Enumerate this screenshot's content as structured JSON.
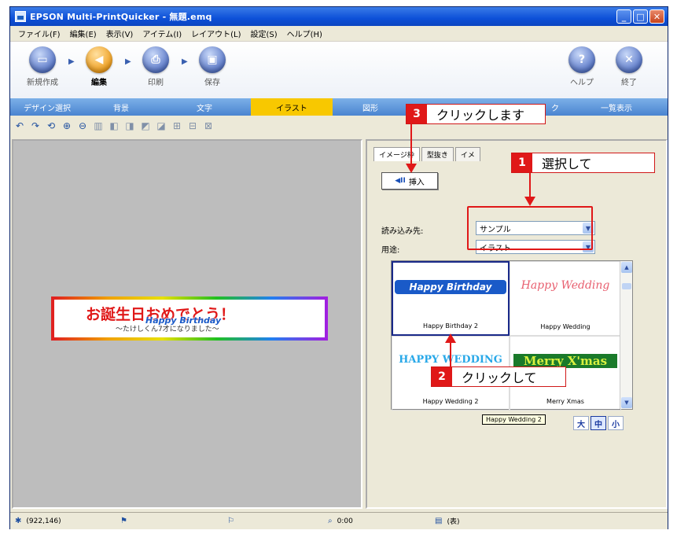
{
  "window": {
    "title": "EPSON Multi-PrintQuicker - 無題.emq"
  },
  "menu": [
    "ファイル(F)",
    "編集(E)",
    "表示(V)",
    "アイテム(I)",
    "レイアウト(L)",
    "設定(S)",
    "ヘルプ(H)"
  ],
  "toolbar": {
    "new_label": "新規作成",
    "edit_label": "編集",
    "print_label": "印刷",
    "save_label": "保存",
    "help_label": "ヘルプ",
    "exit_label": "終了"
  },
  "tabs": [
    "デザイン選択",
    "背景",
    "文字",
    "イラスト",
    "図形",
    "ク",
    "一覧表示"
  ],
  "canvas": {
    "title": "お誕生日おめでとう！",
    "subtitle": "～たけしくん7才になりました～",
    "badge": "Happy Birthday"
  },
  "panel": {
    "subtabs": [
      "イメージ枠",
      "型抜き",
      "イメ"
    ],
    "insert_label": "挿入",
    "source_label": "読み込み先:",
    "source_value": "サンプル",
    "usage_label": "用途:",
    "usage_value": "イラスト",
    "thumbs": [
      {
        "art": "Happy Birthday",
        "caption": "Happy Birthday 2"
      },
      {
        "art": "Happy Wedding",
        "caption": "Happy Wedding"
      },
      {
        "art": "HAPPY WEDDING",
        "caption": "Happy Wedding 2"
      },
      {
        "art": "Merry X'mas",
        "caption": "Merry Xmas"
      }
    ],
    "tooltip": "Happy Wedding 2",
    "sizes": [
      "大",
      "中",
      "小"
    ]
  },
  "status": {
    "coords": "(922,146)",
    "zoom": "0:00",
    "paper": "(表)"
  },
  "callouts": [
    {
      "num": "1",
      "text": "選択して"
    },
    {
      "num": "2",
      "text": "クリックして"
    },
    {
      "num": "3",
      "text": "クリックします"
    }
  ],
  "colors": {
    "accent_tab": "#f8c800",
    "callout_red": "#e01818",
    "title_blue": "#0d50d8"
  }
}
